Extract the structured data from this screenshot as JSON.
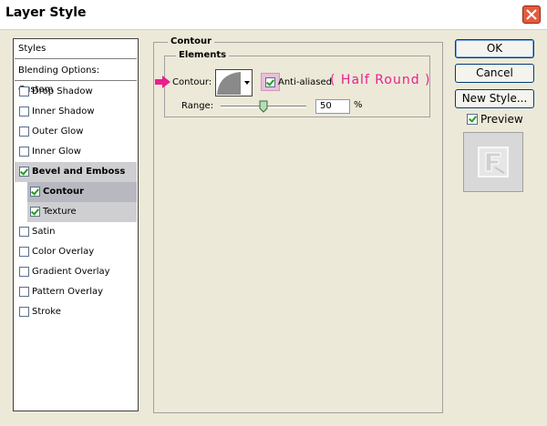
{
  "window": {
    "title": "Layer Style"
  },
  "styles_panel": {
    "styles_header": "Styles",
    "blending_options": "Blending Options: Custom",
    "items": [
      {
        "label": "Drop Shadow",
        "checked": false
      },
      {
        "label": "Inner Shadow",
        "checked": false
      },
      {
        "label": "Outer Glow",
        "checked": false
      },
      {
        "label": "Inner Glow",
        "checked": false
      },
      {
        "label": "Bevel and Emboss",
        "checked": true
      },
      {
        "label": "Contour",
        "checked": true
      },
      {
        "label": "Texture",
        "checked": true
      },
      {
        "label": "Satin",
        "checked": false
      },
      {
        "label": "Color Overlay",
        "checked": false
      },
      {
        "label": "Gradient Overlay",
        "checked": false
      },
      {
        "label": "Pattern Overlay",
        "checked": false
      },
      {
        "label": "Stroke",
        "checked": false
      }
    ]
  },
  "contour_section": {
    "title": "Contour",
    "elements_title": "Elements",
    "contour_label": "Contour:",
    "anti_aliased_label": "Anti-aliased",
    "anti_aliased_checked": true,
    "annotation": "( Half Round )",
    "range_label": "Range:",
    "range_value": "50",
    "range_unit": "%"
  },
  "buttons": {
    "ok": "OK",
    "cancel": "Cancel",
    "new_style": "New Style..."
  },
  "preview": {
    "label": "Preview",
    "checked": true
  },
  "colors": {
    "annotation": "#e8208c",
    "check": "#20a020",
    "selected_row": "#cfcfd2",
    "close_button": "#e65a3c"
  }
}
